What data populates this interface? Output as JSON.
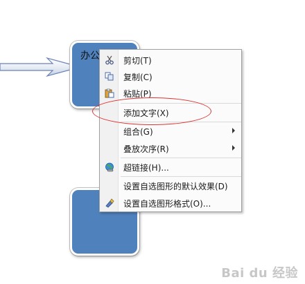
{
  "top_shape_text": "办公",
  "menu": {
    "items": [
      {
        "label": "剪切(T)",
        "icon": "scissors-icon"
      },
      {
        "label": "复制(C)",
        "icon": "copy-icon"
      },
      {
        "label": "粘贴(P)",
        "icon": "paste-icon"
      },
      {
        "label": "添加文字(X)",
        "icon": ""
      },
      {
        "label": "组合(G)",
        "icon": "",
        "submenu": true
      },
      {
        "label": "叠放次序(R)",
        "icon": "",
        "submenu": true
      },
      {
        "label": "超链接(H)...",
        "icon": "hyperlink-globe-icon"
      },
      {
        "label": "设置自选图形的默认效果(D)",
        "icon": ""
      },
      {
        "label": "设置自选图形格式(O)...",
        "icon": "format-shape-icon"
      }
    ]
  },
  "watermark": "Bai du 经验",
  "colors": {
    "shape_fill": "#4f81bd",
    "highlight": "#e03030"
  }
}
